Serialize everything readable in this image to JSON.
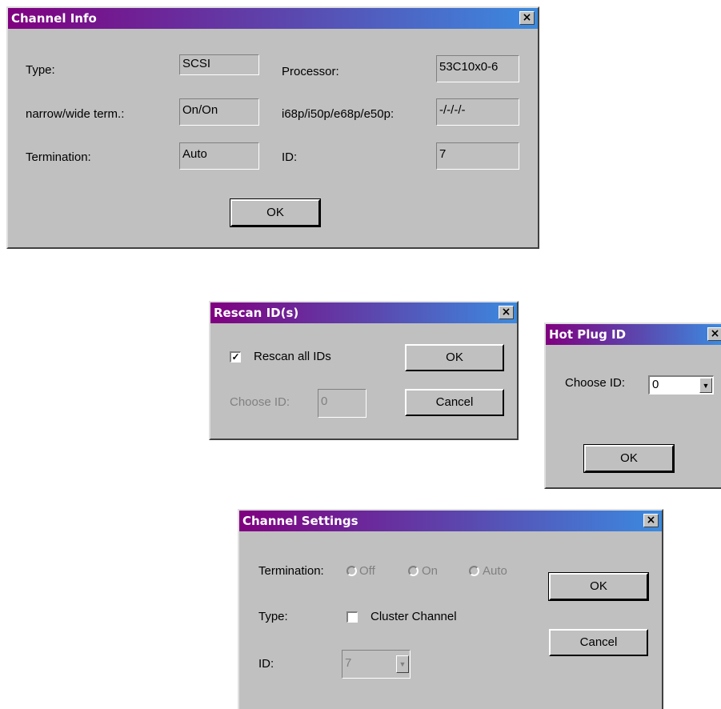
{
  "channel_info": {
    "title": "Channel Info",
    "close_glyph": "×",
    "type_label": "Type:",
    "type_value": "SCSI",
    "processor_label": "Processor:",
    "processor_value": "53C10x0-6",
    "term_label": "narrow/wide term.:",
    "term_value": "On/On",
    "ports_label": "i68p/i50p/e68p/e50p:",
    "ports_value": "-/-/-/-",
    "termination_label": "Termination:",
    "termination_value": "Auto",
    "id_label": "ID:",
    "id_value": "7",
    "ok_label": "OK"
  },
  "rescan": {
    "title": "Rescan ID(s)",
    "close_glyph": "×",
    "rescan_all_label": "Rescan all IDs",
    "rescan_all_checked": true,
    "check_glyph": "✓",
    "choose_id_label": "Choose ID:",
    "choose_id_value": "0",
    "ok_label": "OK",
    "cancel_label": "Cancel"
  },
  "hotplug": {
    "title": "Hot Plug ID",
    "close_glyph": "×",
    "choose_id_label": "Choose ID:",
    "choose_id_value": "0",
    "arrow_glyph": "▼",
    "ok_label": "OK"
  },
  "channel_settings": {
    "title": "Channel Settings",
    "close_glyph": "×",
    "termination_label": "Termination:",
    "termination_options": [
      "Off",
      "On",
      "Auto"
    ],
    "type_label": "Type:",
    "cluster_label": "Cluster Channel",
    "cluster_checked": false,
    "id_label": "ID:",
    "id_value": "7",
    "arrow_glyph": "▼",
    "ok_label": "OK",
    "cancel_label": "Cancel"
  }
}
